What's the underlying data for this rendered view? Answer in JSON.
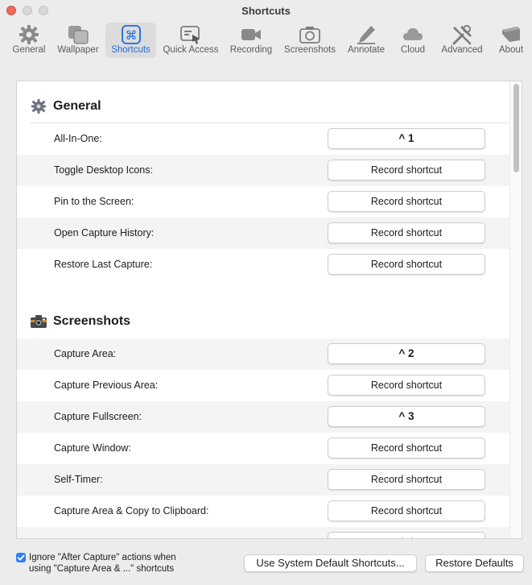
{
  "window": {
    "title": "Shortcuts"
  },
  "toolbar": {
    "items": [
      {
        "label": "General",
        "icon": "gear-icon"
      },
      {
        "label": "Wallpaper",
        "icon": "wallpaper-icon"
      },
      {
        "label": "Shortcuts",
        "icon": "command-key-icon",
        "active": true
      },
      {
        "label": "Quick Access",
        "icon": "quick-access-icon"
      },
      {
        "label": "Recording",
        "icon": "video-camera-icon"
      },
      {
        "label": "Screenshots",
        "icon": "camera-icon"
      },
      {
        "label": "Annotate",
        "icon": "pencil-icon"
      },
      {
        "label": "Cloud",
        "icon": "cloud-icon"
      },
      {
        "label": "Advanced",
        "icon": "tools-icon"
      },
      {
        "label": "About",
        "icon": "about-icon"
      }
    ]
  },
  "sections": {
    "general": {
      "title": "General",
      "icon": "gear-icon",
      "rows": [
        {
          "label": "All-In-One:",
          "button": "^ 1"
        },
        {
          "label": "Toggle Desktop Icons:",
          "button": "Record shortcut"
        },
        {
          "label": "Pin to the Screen:",
          "button": "Record shortcut"
        },
        {
          "label": "Open Capture History:",
          "button": "Record shortcut"
        },
        {
          "label": "Restore Last Capture:",
          "button": "Record shortcut"
        }
      ]
    },
    "screenshots": {
      "title": "Screenshots",
      "icon": "camera-emoji-icon",
      "rows": [
        {
          "label": "Capture Area:",
          "button": "^ 2"
        },
        {
          "label": "Capture Previous Area:",
          "button": "Record shortcut"
        },
        {
          "label": "Capture Fullscreen:",
          "button": "^ 3"
        },
        {
          "label": "Capture Window:",
          "button": "Record shortcut"
        },
        {
          "label": "Self-Timer:",
          "button": "Record shortcut"
        },
        {
          "label": "Capture Area & Copy to Clipboard:",
          "button": "Record shortcut"
        },
        {
          "label": "",
          "button": "Record shortcut"
        }
      ]
    }
  },
  "footer": {
    "checkbox_checked": true,
    "checkbox_line1": "Ignore \"After Capture\" actions when",
    "checkbox_line2": "using \"Capture Area & ...\" shortcuts",
    "system_defaults_button": "Use System Default Shortcuts...",
    "restore_defaults_button": "Restore Defaults"
  },
  "colors": {
    "accent": "#1f6bd9",
    "checkbox": "#2d7ff9",
    "close": "#ed6a5e"
  }
}
